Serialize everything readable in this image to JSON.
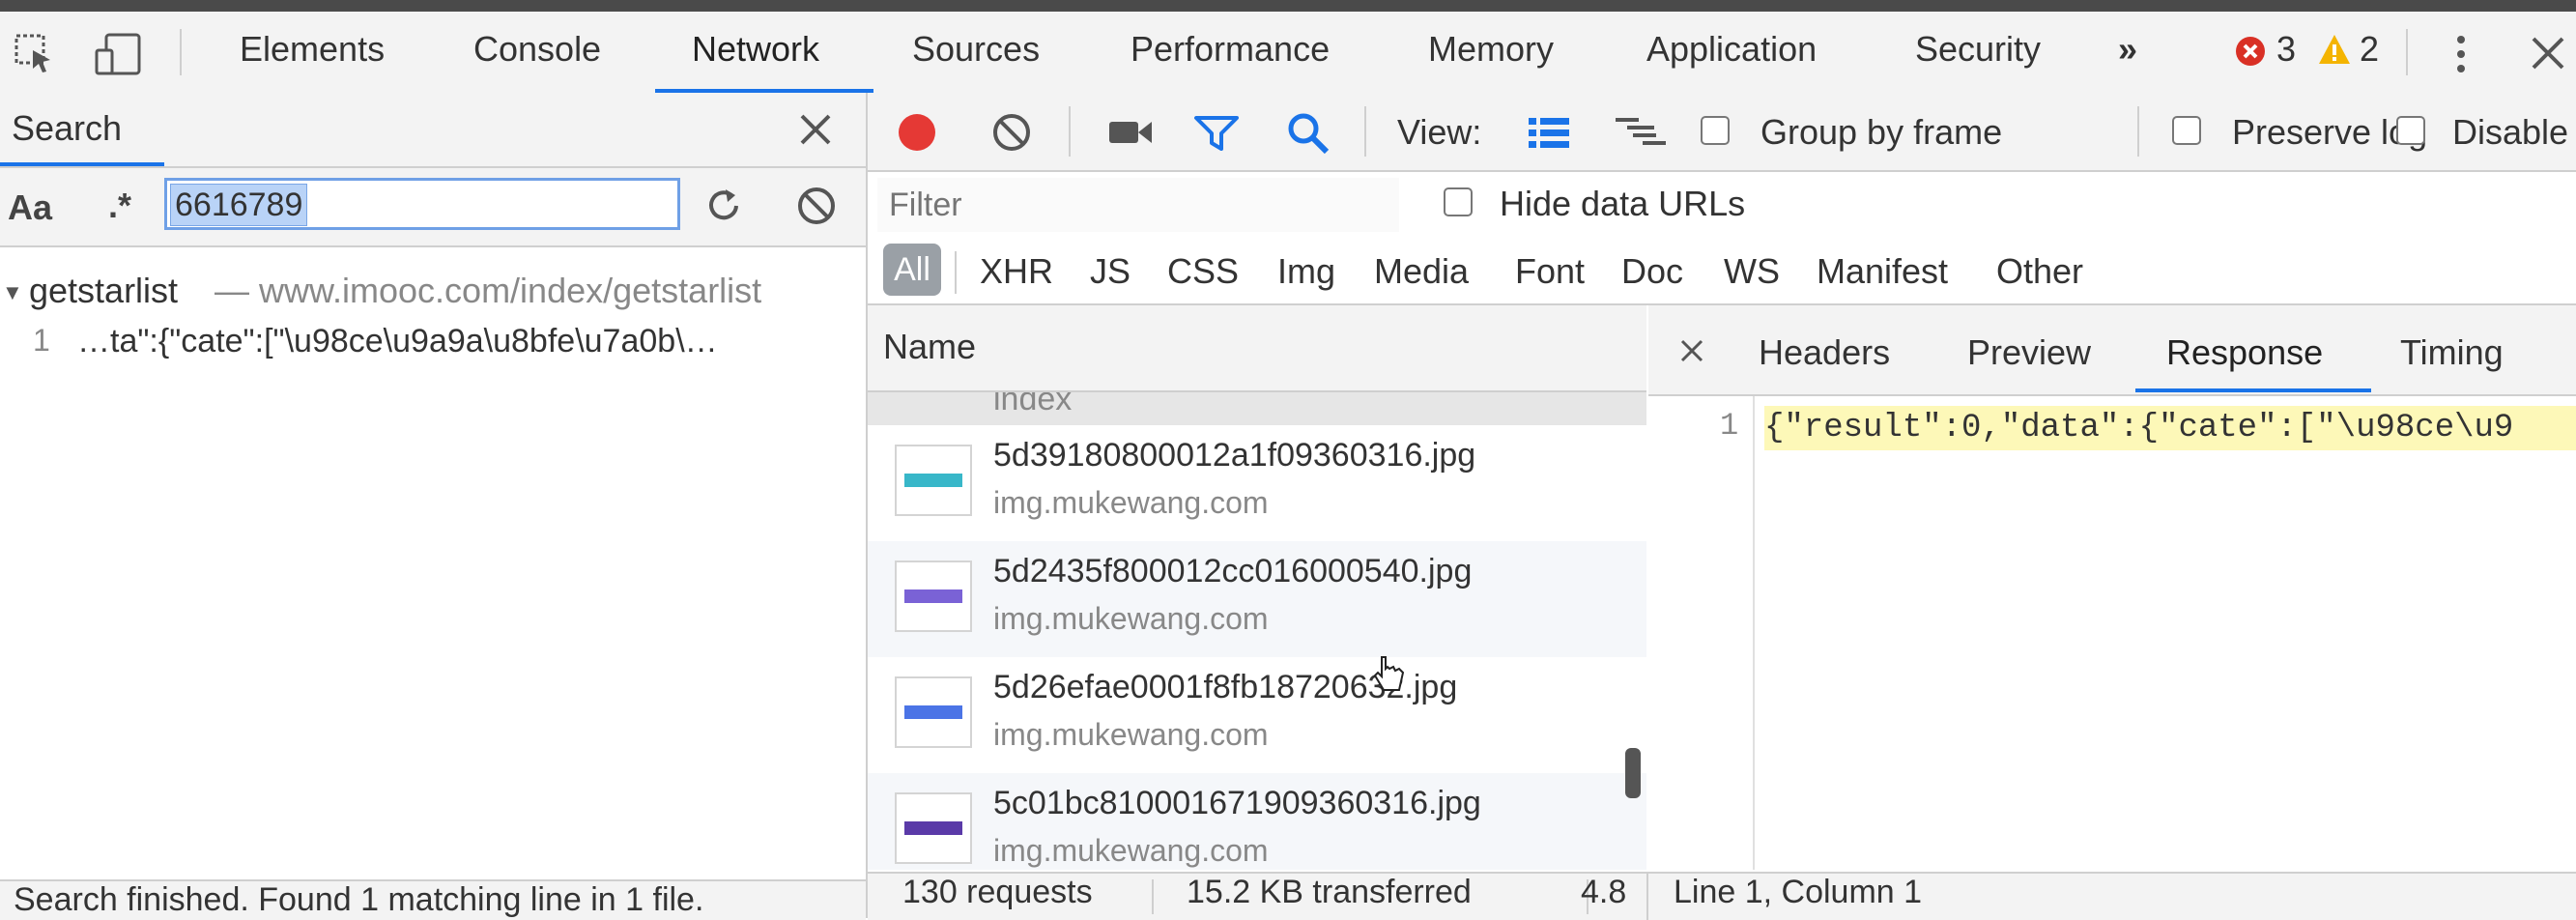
{
  "devtools": {
    "main_tabs": [
      "Elements",
      "Console",
      "Network",
      "Sources",
      "Performance",
      "Memory",
      "Application",
      "Security"
    ],
    "more_tabs_label": "»",
    "error_count": "3",
    "warning_count": "2"
  },
  "search": {
    "title": "Search",
    "case_label": "Aa",
    "regex_label": ".*",
    "query": "6616789",
    "result_file": "getstarlist",
    "result_url": "— www.imooc.com/index/getstarlist",
    "result_line_num": "1",
    "result_line_text": "…ta\":{\"cate\":[\"\\u98ce\\u9a9a\\u8bfe\\u7a0b\\…",
    "status": "Search finished. Found 1 matching line in 1 file."
  },
  "network": {
    "view_label": "View:",
    "group_by_frame": "Group by frame",
    "preserve_log": "Preserve log",
    "disable_cache": "Disable",
    "filter_placeholder": "Filter",
    "hide_data_urls": "Hide data URLs",
    "type_filters": [
      "All",
      "XHR",
      "JS",
      "CSS",
      "Img",
      "Media",
      "Font",
      "Doc",
      "WS",
      "Manifest",
      "Other"
    ],
    "name_header": "Name",
    "partial_row": "index",
    "requests": [
      {
        "name": "5d39180800012a1f09360316.jpg",
        "host": "img.mukewang.com",
        "thumb_color": "#38b7c9"
      },
      {
        "name": "5d2435f800012cc016000540.jpg",
        "host": "img.mukewang.com",
        "thumb_color": "#7a62d6"
      },
      {
        "name": "5d26efae0001f8fb18720632.jpg",
        "host": "img.mukewang.com",
        "thumb_color": "#4b74e6"
      },
      {
        "name": "5c01bc81000167190936031​6.jpg",
        "host": "img.mukewang.com",
        "thumb_color": "#5a3aa8"
      }
    ],
    "status": {
      "requests": "130 requests",
      "transferred": "15.2 KB transferred",
      "extra": "4.8"
    }
  },
  "detail": {
    "tabs": [
      "Headers",
      "Preview",
      "Response",
      "Timing"
    ],
    "active_tab": "Response",
    "line_number": "1",
    "code": "{\"result\":0,\"data\":{\"cate\":[\"\\u98ce\\u9",
    "cursor_position": "Line 1, Column 1"
  },
  "colors": {
    "accent": "#1a73e8",
    "record": "#e53935",
    "highlight": "#fdf8b8"
  }
}
